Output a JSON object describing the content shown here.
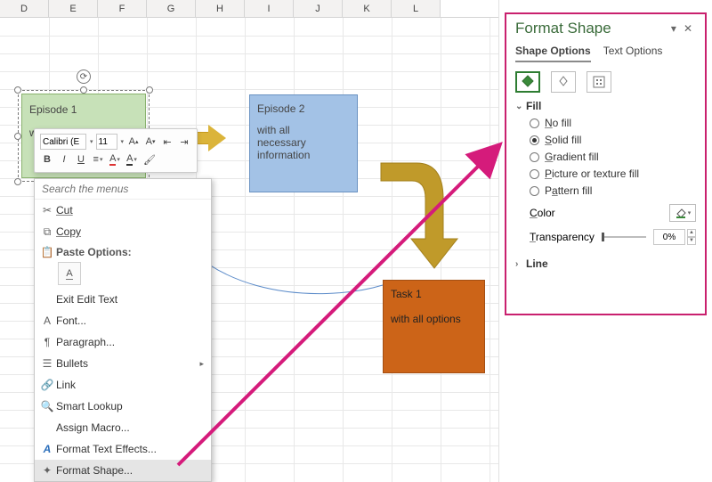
{
  "columns": [
    "D",
    "E",
    "F",
    "G",
    "H",
    "I",
    "J",
    "K",
    "L"
  ],
  "shapes": {
    "ep1": {
      "title": "Episode 1",
      "body": "wi"
    },
    "ep2": {
      "title": "Episode 2",
      "body1": "with all",
      "body2": "necessary",
      "body3": "information"
    },
    "task": {
      "title": "Task 1",
      "body": "with all options"
    }
  },
  "mini_toolbar": {
    "font_name": "Calibri (E",
    "font_size": "11",
    "btn_bold": "B",
    "btn_italic": "I",
    "btn_underline": "U",
    "btn_inc": "A",
    "btn_dec": "A"
  },
  "context_menu": {
    "search_placeholder": "Search the menus",
    "cut": "Cut",
    "copy": "Copy",
    "paste_options": "Paste Options:",
    "paste_keep_text": "A",
    "exit_edit": "Exit Edit Text",
    "font": "Font...",
    "paragraph": "Paragraph...",
    "bullets": "Bullets",
    "link": "Link",
    "smart_lookup": "Smart Lookup",
    "assign_macro": "Assign Macro...",
    "format_text_effects": "Format Text Effects...",
    "format_shape": "Format Shape..."
  },
  "pane": {
    "title": "Format Shape",
    "tab_shape": "Shape Options",
    "tab_text": "Text Options",
    "section_fill": "Fill",
    "fill_none": "No fill",
    "fill_solid": "Solid fill",
    "fill_gradient": "Gradient fill",
    "fill_picture": "Picture or texture fill",
    "fill_pattern": "Pattern fill",
    "color_label": "Color",
    "transparency_label": "Transparency",
    "transparency_value": "0%",
    "section_line": "Line"
  }
}
